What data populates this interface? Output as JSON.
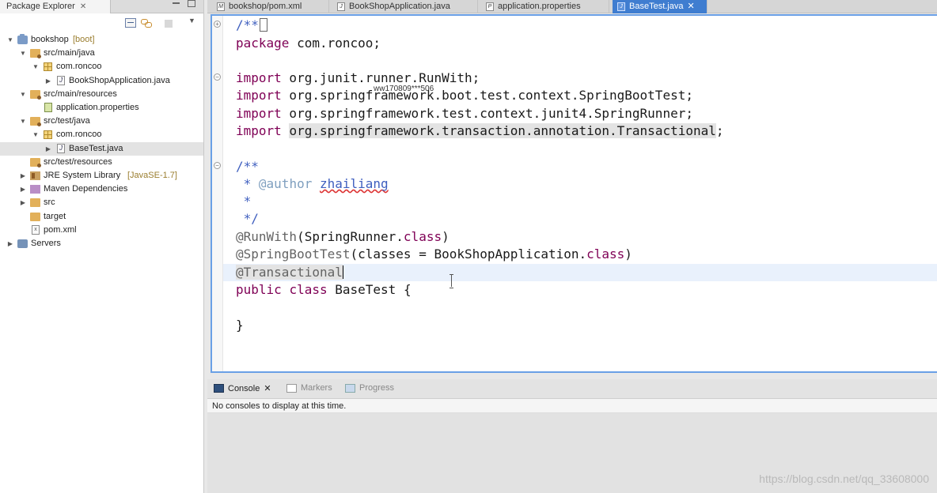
{
  "explorer": {
    "title": "Package Explorer",
    "close": "✕",
    "tree": [
      {
        "label": "bookshop",
        "deco": "[boot]",
        "icon": "project-icon",
        "twisty": "▼"
      },
      {
        "label": "src/main/java",
        "icon": "source-folder-icon",
        "twisty": "▼"
      },
      {
        "label": "com.roncoo",
        "icon": "package-icon",
        "twisty": "▼"
      },
      {
        "label": "BookShopApplication.java",
        "icon": "java-file-icon",
        "twisty": "▶"
      },
      {
        "label": "src/main/resources",
        "icon": "source-folder-icon",
        "twisty": "▼"
      },
      {
        "label": "application.properties",
        "icon": "properties-file-icon",
        "twisty": ""
      },
      {
        "label": "src/test/java",
        "icon": "source-folder-icon",
        "twisty": "▼"
      },
      {
        "label": "com.roncoo",
        "icon": "package-icon",
        "twisty": "▼"
      },
      {
        "label": "BaseTest.java",
        "icon": "java-file-icon",
        "twisty": "▶",
        "selected": true
      },
      {
        "label": "src/test/resources",
        "icon": "source-folder-icon",
        "twisty": ""
      },
      {
        "label": "JRE System Library",
        "deco": "[JavaSE-1.7]",
        "icon": "library-icon",
        "twisty": "▶"
      },
      {
        "label": "Maven Dependencies",
        "icon": "maven-icon",
        "twisty": "▶"
      },
      {
        "label": "src",
        "icon": "folder-icon",
        "twisty": "▶"
      },
      {
        "label": "target",
        "icon": "folder-icon",
        "twisty": ""
      },
      {
        "label": "pom.xml",
        "icon": "xml-file-icon",
        "twisty": ""
      },
      {
        "label": "Servers",
        "icon": "servers-icon",
        "twisty": "▶"
      }
    ]
  },
  "editor_tabs": [
    {
      "label": "bookshop/pom.xml"
    },
    {
      "label": "BookShopApplication.java"
    },
    {
      "label": "application.properties"
    },
    {
      "label": "BaseTest.java",
      "close": "✕"
    }
  ],
  "code": {
    "l1": "/**",
    "l2_kw": "package",
    "l2_rest": " com.roncoo;",
    "l4_kw": "import",
    "l4_rest": " org.junit.runner.RunWith;",
    "l5_kw": "import",
    "l5_rest": " org.springframework.boot.test.context.SpringBootTest;",
    "l6_kw": "import",
    "l6_rest": " org.springframework.test.context.junit4.SpringRunner;",
    "l7_kw": "import",
    "l7_hl": "org.springframework.transaction.annotation.Transactional",
    "l7_end": ";",
    "l9": "/**",
    "l10_star": " * ",
    "l10_tag": "@author",
    "l10_name": "zhailiang",
    "l11": " *",
    "l12": " */",
    "l13_ann": "@RunWith",
    "l13_a": "(SpringRunner.",
    "l13_kw": "class",
    "l13_b": ")",
    "l14_ann": "@SpringBootTest",
    "l14_a": "(classes = BookShopApplication.",
    "l14_kw": "class",
    "l14_b": ")",
    "l15_ann": "@Transactional",
    "l16_kw1": "public",
    "l16_kw2": "class",
    "l16_rest": " BaseTest {",
    "l18": "}",
    "overlay": "ww170809***506"
  },
  "console": {
    "tabs": [
      {
        "label": "Console",
        "close": "✕"
      },
      {
        "label": "Markers"
      },
      {
        "label": "Progress"
      }
    ],
    "message": "No consoles to display at this time.",
    "watermark": "https://blog.csdn.net/qq_33608000"
  }
}
